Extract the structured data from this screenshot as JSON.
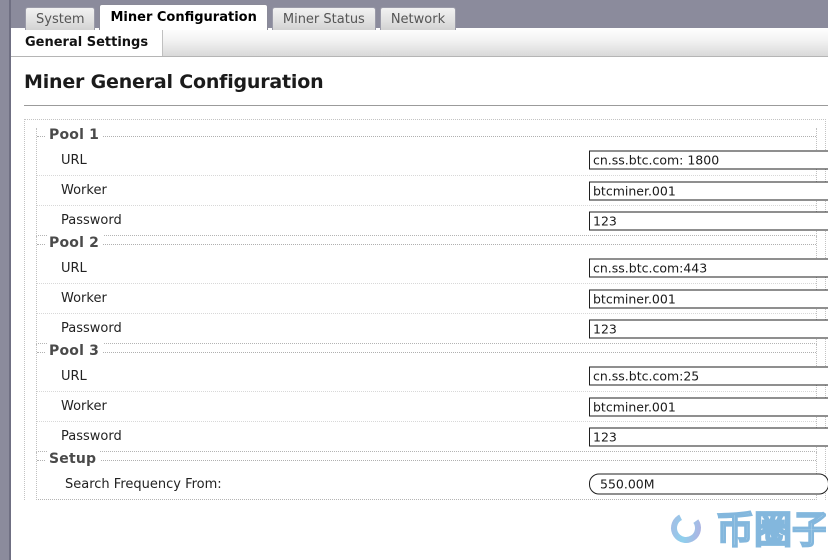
{
  "window": {
    "accent_chrome_color": "#8b8b9c"
  },
  "tabs": {
    "items": [
      {
        "label": "System",
        "active": false
      },
      {
        "label": "Miner Configuration",
        "active": true
      },
      {
        "label": "Miner Status",
        "active": false
      },
      {
        "label": "Network",
        "active": false
      }
    ]
  },
  "subtabs": {
    "items": [
      {
        "label": "General Settings",
        "active": true
      }
    ]
  },
  "main": {
    "title": "Miner General Configuration",
    "groups": [
      {
        "legend": "Pool 1",
        "rows": [
          {
            "label": "URL",
            "value": "cn.ss.btc.com: 1800",
            "style": "square"
          },
          {
            "label": "Worker",
            "value": "btcminer.001",
            "style": "square"
          },
          {
            "label": "Password",
            "value": "123",
            "style": "square"
          }
        ]
      },
      {
        "legend": "Pool 2",
        "rows": [
          {
            "label": "URL",
            "value": "cn.ss.btc.com:443",
            "style": "square"
          },
          {
            "label": "Worker",
            "value": "btcminer.001",
            "style": "square"
          },
          {
            "label": "Password",
            "value": "123",
            "style": "square"
          }
        ]
      },
      {
        "legend": "Pool 3",
        "rows": [
          {
            "label": "URL",
            "value": "cn.ss.btc.com:25",
            "style": "square"
          },
          {
            "label": "Worker",
            "value": "btcminer.001",
            "style": "square"
          },
          {
            "label": "Password",
            "value": "123",
            "style": "square"
          }
        ]
      },
      {
        "legend": "Setup",
        "rows": [
          {
            "label": "Search Frequency From:",
            "value": "550.00M",
            "style": "rounded"
          }
        ]
      }
    ]
  },
  "watermark": {
    "text": "币圈子",
    "swirl_color_outer": "#7b9ad6",
    "swirl_color_inner": "#5bc8e8",
    "text_outline_color": "#5aa9d8"
  }
}
